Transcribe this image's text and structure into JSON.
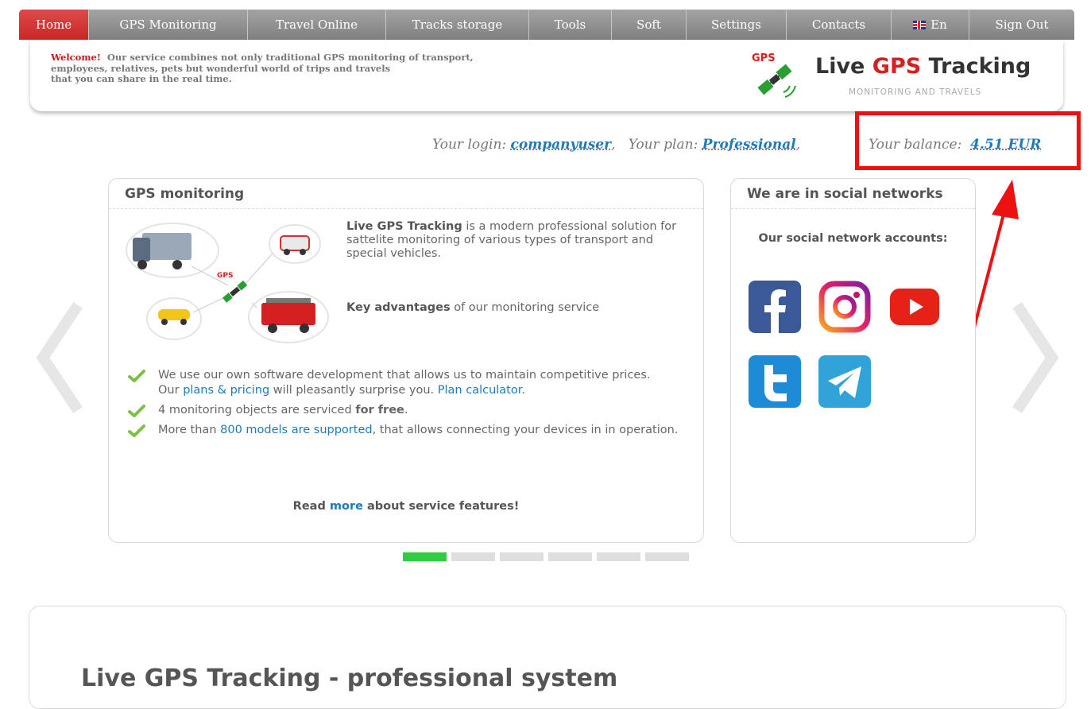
{
  "nav": {
    "items": [
      {
        "label": "Home",
        "active": true
      },
      {
        "label": "GPS Monitoring"
      },
      {
        "label": "Travel Online"
      },
      {
        "label": "Tracks storage"
      },
      {
        "label": "Tools"
      },
      {
        "label": "Soft"
      },
      {
        "label": "Settings"
      },
      {
        "label": "Contacts"
      },
      {
        "label": "En",
        "icon": "uk-flag-icon"
      },
      {
        "label": "Sign Out"
      }
    ]
  },
  "header": {
    "welcome_bold": "Welcome!",
    "welcome_line1": "Our service combines not only traditional GPS monitoring of transport,",
    "welcome_line2": "employees, relatives, pets but wonderful world of trips and travels",
    "welcome_line3": "that you can share in the real time.",
    "logo_badge": "GPS",
    "logo_live": "Live ",
    "logo_gps": "GPS",
    "logo_tracking": " Tracking",
    "logo_sub": "MONITORING AND TRAVELS"
  },
  "account": {
    "login_label": "Your login:",
    "login_value": "companyuser",
    "plan_label": "Your plan:",
    "plan_value": "Professional",
    "balance_label": "Your balance:",
    "balance_value": "4.51 EUR"
  },
  "gps_panel": {
    "title": "GPS monitoring",
    "vehicles_badge": "GPS",
    "intro_bold": "Live GPS Tracking",
    "intro_rest": " is a modern professional solution for sattelite monitoring of various types of transport and special vehicles.",
    "adv_bold": "Key advantages",
    "adv_rest": " of our monitoring service",
    "f1_a": "We use our own software development that allows us to maintain competitive prices.",
    "f1_b": "Our ",
    "f1_link1": "plans & pricing",
    "f1_c": " will pleasantly surprise you. ",
    "f1_link2": "Plan calculator",
    "f1_d": ".",
    "f2_a": "4 monitoring objects are serviced ",
    "f2_bold": "for free",
    "f2_b": ".",
    "f3_a": "More than ",
    "f3_link": "800 models are supported",
    "f3_b": ", that allows connecting your devices in in operation.",
    "read_a": "Read ",
    "read_link": "more",
    "read_b": " about service features!"
  },
  "social_panel": {
    "title": "We are in social networks",
    "subtitle": "Our social network accounts:",
    "icons": [
      "facebook-icon",
      "instagram-icon",
      "youtube-icon",
      "twitter-icon",
      "telegram-icon"
    ]
  },
  "carousel": {
    "active_index": 0,
    "count": 6
  },
  "bottom": {
    "heading": "Live GPS Tracking - professional system"
  },
  "colors": {
    "nav_active": "#d83434",
    "nav_bg": "#8e8e8e",
    "link": "#1f7bb8",
    "highlight": "#ee1111",
    "dot_active": "#2ecc40"
  }
}
